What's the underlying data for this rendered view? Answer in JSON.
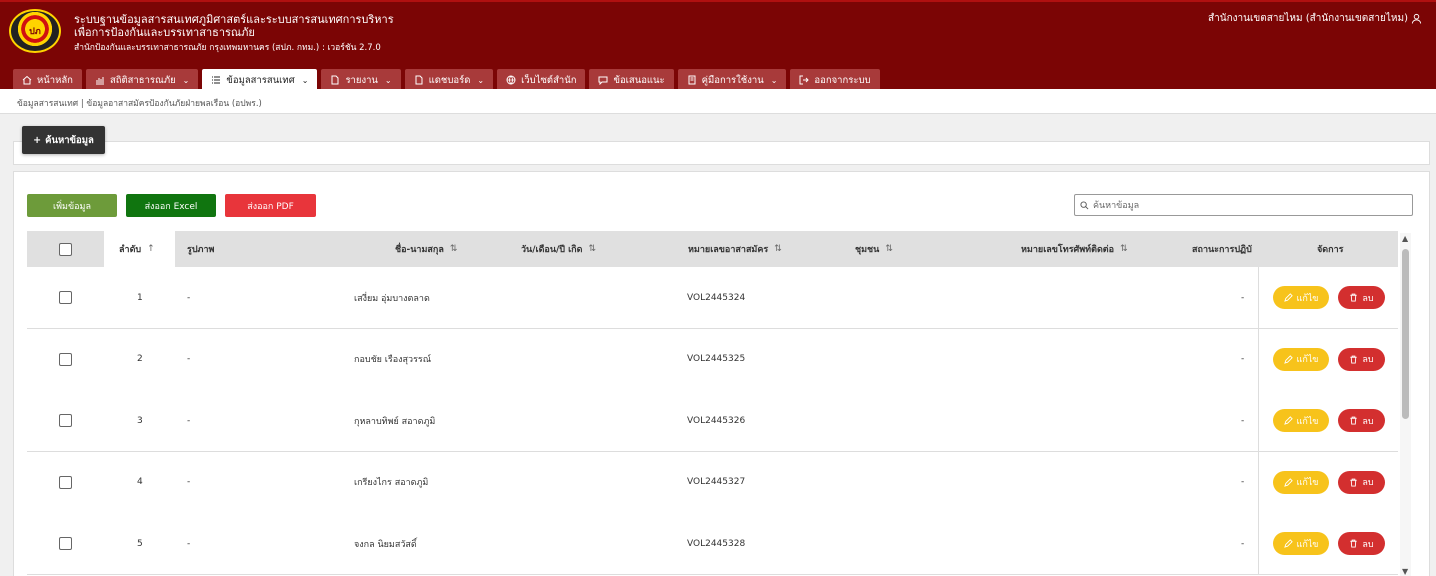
{
  "header": {
    "title_line1": "ระบบฐานข้อมูลสารสนเทศภูมิศาสตร์และระบบสารสนเทศการบริหาร",
    "title_line2": "เพื่อการป้องกันและบรรเทาสาธารณภัย",
    "subtitle": "สำนักป้องกันและบรรเทาสาธารณภัย กรุงเทพมหานคร (สปภ. กทม.) : เวอร์ชัน 2.7.0",
    "organization": "สำนักงานเขตสายไหม (สำนักงานเขตสายไหม)",
    "logo_text": "ปภ"
  },
  "nav": {
    "tabs": [
      {
        "label": "หน้าหลัก",
        "icon": "home-icon",
        "dropdown": false,
        "active": false
      },
      {
        "label": "สถิติสาธารณภัย",
        "icon": "chart-icon",
        "dropdown": true,
        "active": false
      },
      {
        "label": "ข้อมูลสารสนเทศ",
        "icon": "list-icon",
        "dropdown": true,
        "active": true
      },
      {
        "label": "รายงาน",
        "icon": "file-icon",
        "dropdown": true,
        "active": false
      },
      {
        "label": "แดชบอร์ด",
        "icon": "file-icon",
        "dropdown": true,
        "active": false
      },
      {
        "label": "เว็บไซต์สำนัก",
        "icon": "globe-icon",
        "dropdown": false,
        "active": false
      },
      {
        "label": "ข้อเสนอแนะ",
        "icon": "comment-icon",
        "dropdown": false,
        "active": false
      },
      {
        "label": "คู่มือการใช้งาน",
        "icon": "book-icon",
        "dropdown": true,
        "active": false
      },
      {
        "label": "ออกจากระบบ",
        "icon": "logout-icon",
        "dropdown": false,
        "active": false
      }
    ]
  },
  "breadcrumb": "ข้อมูลสารสนเทศ | ข้อมูลอาสาสมัครป้องกันภัยฝ่ายพลเรือน (อปพร.)",
  "search_toggle_label": "ค้นหาข้อมูล",
  "toolbar": {
    "add_label": "เพิ่มข้อมูล",
    "excel_label": "ส่งออก Excel",
    "pdf_label": "ส่งออก PDF",
    "search_placeholder": "ค้นหาข้อมูล"
  },
  "table": {
    "headers": {
      "order": "ลำดับ",
      "photo": "รูปภาพ",
      "name": "ชื่อ-นามสกุล",
      "birthdate": "วัน/เดือน/ปี เกิด",
      "volunteer_no": "หมายเลขอาสาสมัคร",
      "community": "ชุมชน",
      "phone": "หมายเลขโทรศัพท์ติดต่อ",
      "status": "สถานะการปฏิบั",
      "actions": "จัดการ"
    },
    "edit_label": "แก้ไข",
    "delete_label": "ลบ",
    "rows": [
      {
        "order": "1",
        "photo": "-",
        "name": "เสงี่ยม อุ่มบางตลาด",
        "volunteer_no": "VOL2445324",
        "status": "-"
      },
      {
        "order": "2",
        "photo": "-",
        "name": "กอบชัย เรืองสุวรรณ์",
        "volunteer_no": "VOL2445325",
        "status": "-"
      },
      {
        "order": "3",
        "photo": "-",
        "name": "กุหลาบทิพย์ สอาดภูมิ",
        "volunteer_no": "VOL2445326",
        "status": "-"
      },
      {
        "order": "4",
        "photo": "-",
        "name": "เกรียงไกร สอาดภูมิ",
        "volunteer_no": "VOL2445327",
        "status": "-"
      },
      {
        "order": "5",
        "photo": "-",
        "name": "จงกล นิยมสวัสดิ์",
        "volunteer_no": "VOL2445328",
        "status": "-"
      }
    ]
  },
  "colors": {
    "header_bg": "#7b0505",
    "tab_bg": "#a83a3a",
    "add_btn": "#6d9b3a",
    "excel_btn": "#10750f",
    "pdf_btn": "#e8353b",
    "edit_btn": "#f7c31b",
    "delete_btn": "#d32f2f"
  }
}
